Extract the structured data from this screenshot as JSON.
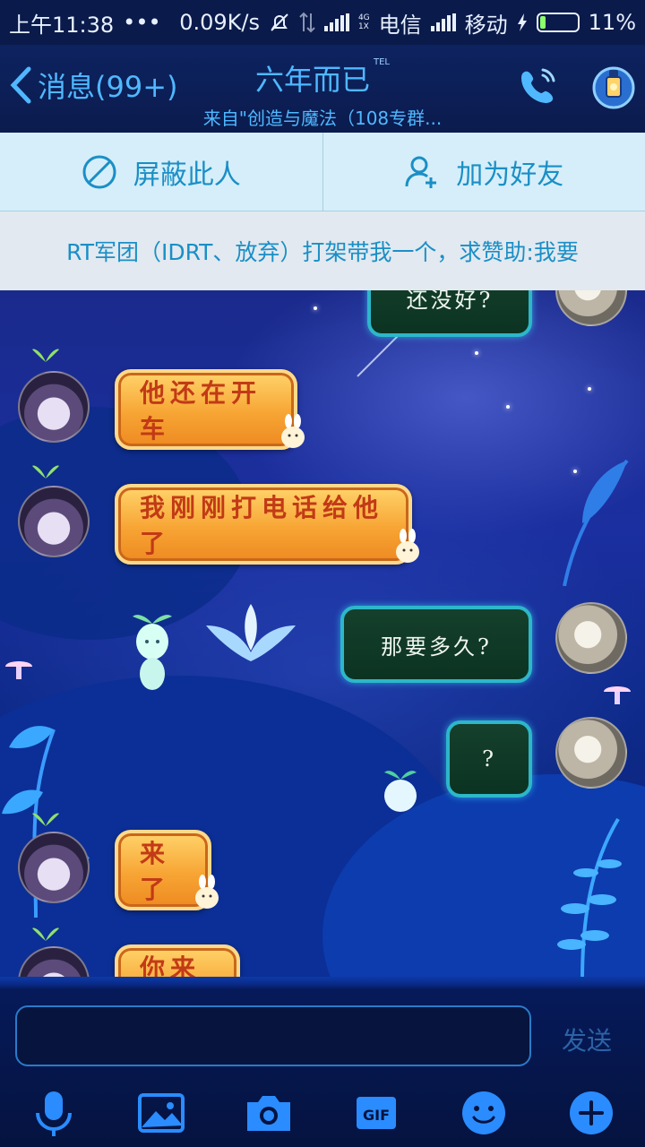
{
  "status_bar": {
    "time": "上午11:38",
    "dots": "•••",
    "net_speed": "0.09K/s",
    "net_type": "4G",
    "net_sub": "1X",
    "carrier1": "电信",
    "carrier2": "移动",
    "battery": "11%"
  },
  "header": {
    "back_label": "消息(99+)",
    "title": "六年而已",
    "tel_badge": "TEL",
    "subtitle": "来自\"创造与魔法（108专群..."
  },
  "actions": {
    "block_label": "屏蔽此人",
    "add_friend_label": "加为好友"
  },
  "notice": {
    "text": "RT军团（IDRT、放弃）打架带我一个，求赞助:我要"
  },
  "messages": [
    {
      "side": "right",
      "text": "还没好?"
    },
    {
      "side": "left",
      "text": "他还在开车"
    },
    {
      "side": "left",
      "text": "我刚刚打电话给他了"
    },
    {
      "side": "right",
      "text": "那要多久?"
    },
    {
      "side": "right",
      "text": "?"
    },
    {
      "side": "left",
      "text": "来了"
    },
    {
      "side": "left",
      "text": "你来了"
    }
  ],
  "composer": {
    "input_value": "",
    "send_label": "发送"
  },
  "colors": {
    "accent": "#4fb8ff",
    "action_bar_bg": "#d5eef9",
    "action_text": "#1a8fc6",
    "orange_bubble": "#f7a534",
    "green_bubble": "#0c3322",
    "bubble_border": "#2db7c9"
  }
}
